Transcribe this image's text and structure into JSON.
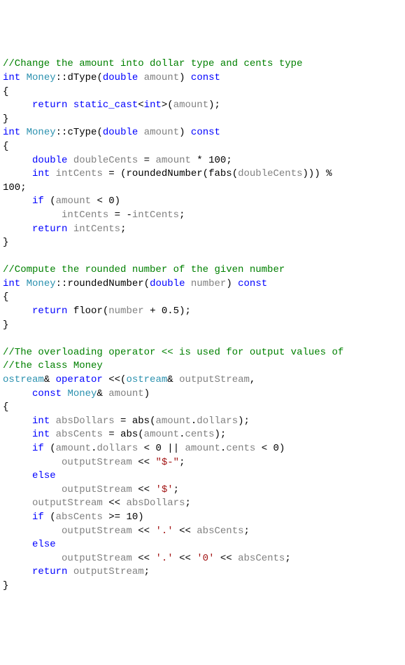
{
  "tokens": [
    {
      "cls": "c-comment",
      "t": "//Change the amount into dollar type and cents type"
    },
    {
      "cls": "nl"
    },
    {
      "cls": "c-keyword",
      "t": "int"
    },
    {
      "cls": "c-text",
      "t": " "
    },
    {
      "cls": "c-type",
      "t": "Money"
    },
    {
      "cls": "c-text",
      "t": "::dType("
    },
    {
      "cls": "c-keyword",
      "t": "double"
    },
    {
      "cls": "c-text",
      "t": " "
    },
    {
      "cls": "c-ident",
      "t": "amount"
    },
    {
      "cls": "c-text",
      "t": ") "
    },
    {
      "cls": "c-keyword",
      "t": "const"
    },
    {
      "cls": "nl"
    },
    {
      "cls": "c-text",
      "t": "{"
    },
    {
      "cls": "nl"
    },
    {
      "cls": "c-text",
      "t": "     "
    },
    {
      "cls": "c-keyword",
      "t": "return"
    },
    {
      "cls": "c-text",
      "t": " "
    },
    {
      "cls": "c-keyword",
      "t": "static_cast"
    },
    {
      "cls": "c-text",
      "t": "<"
    },
    {
      "cls": "c-keyword",
      "t": "int"
    },
    {
      "cls": "c-text",
      "t": ">("
    },
    {
      "cls": "c-ident",
      "t": "amount"
    },
    {
      "cls": "c-text",
      "t": ");"
    },
    {
      "cls": "nl"
    },
    {
      "cls": "c-text",
      "t": "}"
    },
    {
      "cls": "nl"
    },
    {
      "cls": "c-keyword",
      "t": "int"
    },
    {
      "cls": "c-text",
      "t": " "
    },
    {
      "cls": "c-type",
      "t": "Money"
    },
    {
      "cls": "c-text",
      "t": "::cType("
    },
    {
      "cls": "c-keyword",
      "t": "double"
    },
    {
      "cls": "c-text",
      "t": " "
    },
    {
      "cls": "c-ident",
      "t": "amount"
    },
    {
      "cls": "c-text",
      "t": ") "
    },
    {
      "cls": "c-keyword",
      "t": "const"
    },
    {
      "cls": "nl"
    },
    {
      "cls": "c-text",
      "t": "{"
    },
    {
      "cls": "nl"
    },
    {
      "cls": "c-text",
      "t": "     "
    },
    {
      "cls": "c-keyword",
      "t": "double"
    },
    {
      "cls": "c-text",
      "t": " "
    },
    {
      "cls": "c-ident",
      "t": "doubleCents"
    },
    {
      "cls": "c-text",
      "t": " = "
    },
    {
      "cls": "c-ident",
      "t": "amount"
    },
    {
      "cls": "c-text",
      "t": " * 100;"
    },
    {
      "cls": "nl"
    },
    {
      "cls": "c-text",
      "t": "     "
    },
    {
      "cls": "c-keyword",
      "t": "int"
    },
    {
      "cls": "c-text",
      "t": " "
    },
    {
      "cls": "c-ident",
      "t": "intCents"
    },
    {
      "cls": "c-text",
      "t": " = (roundedNumber(fabs("
    },
    {
      "cls": "c-ident",
      "t": "doubleCents"
    },
    {
      "cls": "c-text",
      "t": "))) % "
    },
    {
      "cls": "nl"
    },
    {
      "cls": "c-text",
      "t": "100;"
    },
    {
      "cls": "nl"
    },
    {
      "cls": "c-text",
      "t": "     "
    },
    {
      "cls": "c-keyword",
      "t": "if"
    },
    {
      "cls": "c-text",
      "t": " ("
    },
    {
      "cls": "c-ident",
      "t": "amount"
    },
    {
      "cls": "c-text",
      "t": " < 0)"
    },
    {
      "cls": "nl"
    },
    {
      "cls": "c-text",
      "t": "          "
    },
    {
      "cls": "c-ident",
      "t": "intCents"
    },
    {
      "cls": "c-text",
      "t": " = -"
    },
    {
      "cls": "c-ident",
      "t": "intCents"
    },
    {
      "cls": "c-text",
      "t": ";"
    },
    {
      "cls": "nl"
    },
    {
      "cls": "c-text",
      "t": "     "
    },
    {
      "cls": "c-keyword",
      "t": "return"
    },
    {
      "cls": "c-text",
      "t": " "
    },
    {
      "cls": "c-ident",
      "t": "intCents"
    },
    {
      "cls": "c-text",
      "t": ";"
    },
    {
      "cls": "nl"
    },
    {
      "cls": "c-text",
      "t": "}"
    },
    {
      "cls": "nl"
    },
    {
      "cls": "nl"
    },
    {
      "cls": "c-comment",
      "t": "//Compute the rounded number of the given number"
    },
    {
      "cls": "nl"
    },
    {
      "cls": "c-keyword",
      "t": "int"
    },
    {
      "cls": "c-text",
      "t": " "
    },
    {
      "cls": "c-type",
      "t": "Money"
    },
    {
      "cls": "c-text",
      "t": "::roundedNumber("
    },
    {
      "cls": "c-keyword",
      "t": "double"
    },
    {
      "cls": "c-text",
      "t": " "
    },
    {
      "cls": "c-ident",
      "t": "number"
    },
    {
      "cls": "c-text",
      "t": ") "
    },
    {
      "cls": "c-keyword",
      "t": "const"
    },
    {
      "cls": "nl"
    },
    {
      "cls": "c-text",
      "t": "{"
    },
    {
      "cls": "nl"
    },
    {
      "cls": "c-text",
      "t": "     "
    },
    {
      "cls": "c-keyword",
      "t": "return"
    },
    {
      "cls": "c-text",
      "t": " floor("
    },
    {
      "cls": "c-ident",
      "t": "number"
    },
    {
      "cls": "c-text",
      "t": " + 0.5);"
    },
    {
      "cls": "nl"
    },
    {
      "cls": "c-text",
      "t": "}"
    },
    {
      "cls": "nl"
    },
    {
      "cls": "nl"
    },
    {
      "cls": "c-comment",
      "t": "//The overloading operator << is used for output values of"
    },
    {
      "cls": "nl"
    },
    {
      "cls": "c-comment",
      "t": "//the class Money"
    },
    {
      "cls": "nl"
    },
    {
      "cls": "c-type",
      "t": "ostream"
    },
    {
      "cls": "c-text",
      "t": "& "
    },
    {
      "cls": "c-keyword",
      "t": "operator"
    },
    {
      "cls": "c-text",
      "t": " <<("
    },
    {
      "cls": "c-type",
      "t": "ostream"
    },
    {
      "cls": "c-text",
      "t": "& "
    },
    {
      "cls": "c-ident",
      "t": "outputStream"
    },
    {
      "cls": "c-text",
      "t": ","
    },
    {
      "cls": "nl"
    },
    {
      "cls": "c-text",
      "t": "     "
    },
    {
      "cls": "c-keyword",
      "t": "const"
    },
    {
      "cls": "c-text",
      "t": " "
    },
    {
      "cls": "c-type",
      "t": "Money"
    },
    {
      "cls": "c-text",
      "t": "& "
    },
    {
      "cls": "c-ident",
      "t": "amount"
    },
    {
      "cls": "c-text",
      "t": ")"
    },
    {
      "cls": "nl"
    },
    {
      "cls": "c-text",
      "t": "{"
    },
    {
      "cls": "nl"
    },
    {
      "cls": "c-text",
      "t": "     "
    },
    {
      "cls": "c-keyword",
      "t": "int"
    },
    {
      "cls": "c-text",
      "t": " "
    },
    {
      "cls": "c-ident",
      "t": "absDollars"
    },
    {
      "cls": "c-text",
      "t": " = abs("
    },
    {
      "cls": "c-ident",
      "t": "amount"
    },
    {
      "cls": "c-text",
      "t": "."
    },
    {
      "cls": "c-ident",
      "t": "dollars"
    },
    {
      "cls": "c-text",
      "t": ");"
    },
    {
      "cls": "nl"
    },
    {
      "cls": "c-text",
      "t": "     "
    },
    {
      "cls": "c-keyword",
      "t": "int"
    },
    {
      "cls": "c-text",
      "t": " "
    },
    {
      "cls": "c-ident",
      "t": "absCents"
    },
    {
      "cls": "c-text",
      "t": " = abs("
    },
    {
      "cls": "c-ident",
      "t": "amount"
    },
    {
      "cls": "c-text",
      "t": "."
    },
    {
      "cls": "c-ident",
      "t": "cents"
    },
    {
      "cls": "c-text",
      "t": ");"
    },
    {
      "cls": "nl"
    },
    {
      "cls": "c-text",
      "t": "     "
    },
    {
      "cls": "c-keyword",
      "t": "if"
    },
    {
      "cls": "c-text",
      "t": " ("
    },
    {
      "cls": "c-ident",
      "t": "amount"
    },
    {
      "cls": "c-text",
      "t": "."
    },
    {
      "cls": "c-ident",
      "t": "dollars"
    },
    {
      "cls": "c-text",
      "t": " < 0 || "
    },
    {
      "cls": "c-ident",
      "t": "amount"
    },
    {
      "cls": "c-text",
      "t": "."
    },
    {
      "cls": "c-ident",
      "t": "cents"
    },
    {
      "cls": "c-text",
      "t": " < 0)"
    },
    {
      "cls": "nl"
    },
    {
      "cls": "c-text",
      "t": "          "
    },
    {
      "cls": "c-ident",
      "t": "outputStream"
    },
    {
      "cls": "c-text",
      "t": " << "
    },
    {
      "cls": "c-string",
      "t": "\"$-\""
    },
    {
      "cls": "c-text",
      "t": ";"
    },
    {
      "cls": "nl"
    },
    {
      "cls": "c-text",
      "t": "     "
    },
    {
      "cls": "c-keyword",
      "t": "else"
    },
    {
      "cls": "nl"
    },
    {
      "cls": "c-text",
      "t": "          "
    },
    {
      "cls": "c-ident",
      "t": "outputStream"
    },
    {
      "cls": "c-text",
      "t": " << "
    },
    {
      "cls": "c-string",
      "t": "'$'"
    },
    {
      "cls": "c-text",
      "t": ";"
    },
    {
      "cls": "nl"
    },
    {
      "cls": "c-text",
      "t": "     "
    },
    {
      "cls": "c-ident",
      "t": "outputStream"
    },
    {
      "cls": "c-text",
      "t": " << "
    },
    {
      "cls": "c-ident",
      "t": "absDollars"
    },
    {
      "cls": "c-text",
      "t": ";"
    },
    {
      "cls": "nl"
    },
    {
      "cls": "c-text",
      "t": "     "
    },
    {
      "cls": "c-keyword",
      "t": "if"
    },
    {
      "cls": "c-text",
      "t": " ("
    },
    {
      "cls": "c-ident",
      "t": "absCents"
    },
    {
      "cls": "c-text",
      "t": " >= 10)"
    },
    {
      "cls": "nl"
    },
    {
      "cls": "c-text",
      "t": "          "
    },
    {
      "cls": "c-ident",
      "t": "outputStream"
    },
    {
      "cls": "c-text",
      "t": " << "
    },
    {
      "cls": "c-string",
      "t": "'.'"
    },
    {
      "cls": "c-text",
      "t": " << "
    },
    {
      "cls": "c-ident",
      "t": "absCents"
    },
    {
      "cls": "c-text",
      "t": ";"
    },
    {
      "cls": "nl"
    },
    {
      "cls": "c-text",
      "t": "     "
    },
    {
      "cls": "c-keyword",
      "t": "else"
    },
    {
      "cls": "nl"
    },
    {
      "cls": "c-text",
      "t": "          "
    },
    {
      "cls": "c-ident",
      "t": "outputStream"
    },
    {
      "cls": "c-text",
      "t": " << "
    },
    {
      "cls": "c-string",
      "t": "'.'"
    },
    {
      "cls": "c-text",
      "t": " << "
    },
    {
      "cls": "c-string",
      "t": "'0'"
    },
    {
      "cls": "c-text",
      "t": " << "
    },
    {
      "cls": "c-ident",
      "t": "absCents"
    },
    {
      "cls": "c-text",
      "t": ";"
    },
    {
      "cls": "nl"
    },
    {
      "cls": "c-text",
      "t": "     "
    },
    {
      "cls": "c-keyword",
      "t": "return"
    },
    {
      "cls": "c-text",
      "t": " "
    },
    {
      "cls": "c-ident",
      "t": "outputStream"
    },
    {
      "cls": "c-text",
      "t": ";"
    },
    {
      "cls": "nl"
    },
    {
      "cls": "c-text",
      "t": "}"
    }
  ]
}
